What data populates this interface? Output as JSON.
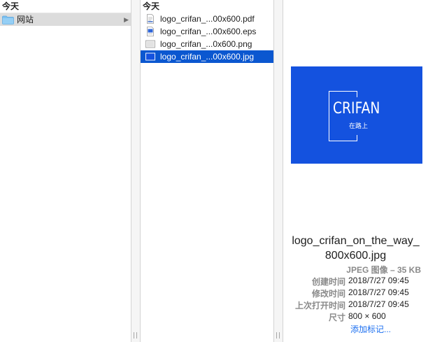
{
  "column1": {
    "header": "今天",
    "items": [
      {
        "label": "网站",
        "type": "folder",
        "selected": true
      }
    ]
  },
  "column2": {
    "header": "今天",
    "files": [
      {
        "label": "logo_crifan_...00x600.pdf",
        "icon": "pdf-file-icon"
      },
      {
        "label": "logo_crifan_...00x600.eps",
        "icon": "eps-file-icon"
      },
      {
        "label": "logo_crifan_...0x600.png",
        "icon": "png-file-icon"
      },
      {
        "label": "logo_crifan_...00x600.jpg",
        "icon": "jpg-file-icon",
        "selected": true
      }
    ]
  },
  "preview": {
    "logo_text": "CRIFAN",
    "logo_subtext": "在路上",
    "background_color": "#1452df",
    "file_name_line1": "logo_crifan_on_the_way_",
    "file_name_line2": "800x600.jpg",
    "kind": "JPEG 图像 – 35 KB",
    "meta": [
      {
        "label": "创建时间",
        "value": "2018/7/27 09:45"
      },
      {
        "label": "修改时间",
        "value": "2018/7/27 09:45"
      },
      {
        "label": "上次打开时间",
        "value": "2018/7/27 09:45"
      },
      {
        "label": "尺寸",
        "value": "800 × 600"
      }
    ],
    "add_tags": "添加标记..."
  },
  "gutter_grip": "||",
  "colors": {
    "selection": "#0b57d0",
    "folder_selection": "#dcdcdc",
    "link": "#1a6ef0"
  }
}
